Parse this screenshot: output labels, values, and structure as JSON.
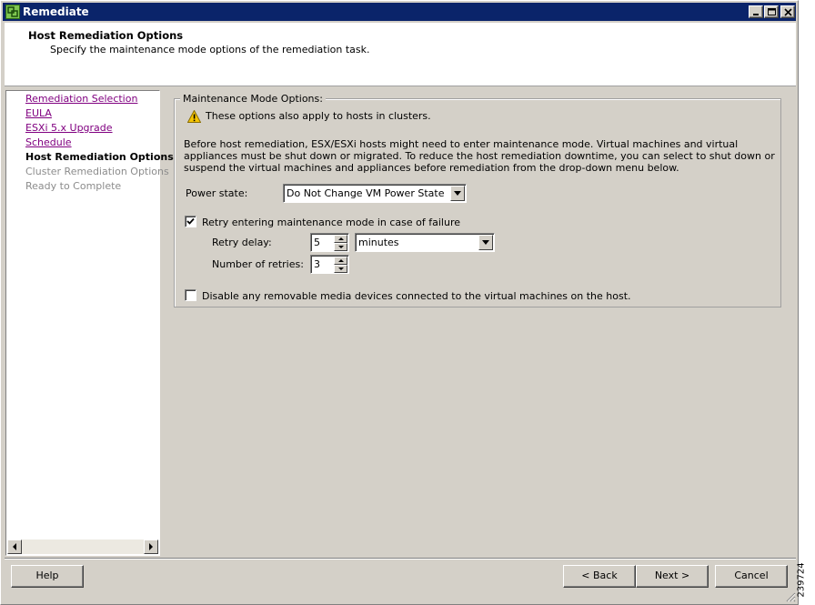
{
  "window": {
    "title": "Remediate",
    "minimize_icon": "minimize-icon",
    "maximize_icon": "maximize-icon",
    "close_icon": "close-icon"
  },
  "header": {
    "title": "Host Remediation Options",
    "subtitle": "Specify the maintenance mode options of the remediation task."
  },
  "steps": [
    {
      "label": "Remediation Selection",
      "state": "visited"
    },
    {
      "label": "EULA",
      "state": "visited"
    },
    {
      "label": "ESXi 5.x Upgrade",
      "state": "visited"
    },
    {
      "label": "Schedule",
      "state": "visited"
    },
    {
      "label": "Host Remediation Options",
      "state": "current"
    },
    {
      "label": "Cluster Remediation Options",
      "state": "disabled"
    },
    {
      "label": "Ready to Complete",
      "state": "disabled"
    }
  ],
  "maintenance": {
    "legend": "Maintenance Mode Options:",
    "warning_icon": "warning-icon",
    "warning": "These options also apply to hosts in clusters.",
    "description": "Before host remediation, ESX/ESXi hosts might need to enter maintenance mode. Virtual machines and virtual appliances must be shut down or migrated. To reduce the host remediation downtime, you can select to shut down or suspend the virtual machines and appliances before remediation from the drop-down menu below.",
    "power_state_label": "Power state:",
    "power_state_value": "Do Not Change VM Power State",
    "retry_label": "Retry entering maintenance mode in case of failure",
    "retry_checked": true,
    "retry_delay_label": "Retry delay:",
    "retry_delay_value": "5",
    "retry_delay_unit": "minutes",
    "retries_label": "Number of retries:",
    "retries_value": "3",
    "disable_media_label": "Disable any removable media devices connected to the virtual machines on the host.",
    "disable_media_checked": false
  },
  "buttons": {
    "help": "Help",
    "back": "< Back",
    "next": "Next >",
    "cancel": "Cancel"
  },
  "figure_id": "239724",
  "colors": {
    "titlebar": "#0a246a",
    "dialog_bg": "#d4d0c8",
    "visited_link": "#800080",
    "disabled_text": "#8c8c8c",
    "warning": "#f5c400"
  }
}
